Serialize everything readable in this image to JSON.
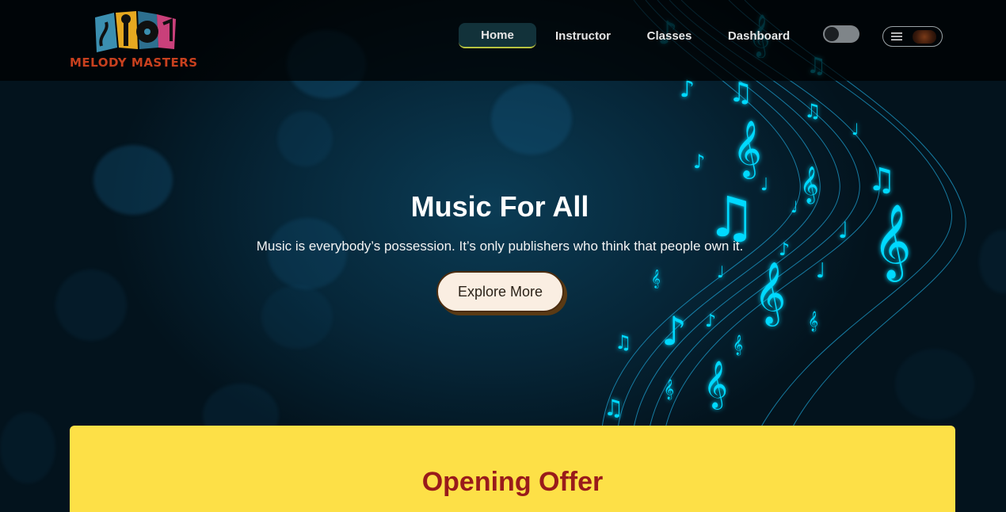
{
  "brand": {
    "name": "MELODY MASTERS",
    "logo_icon": "music-instruments-logo",
    "logo_color": "#c8401e"
  },
  "nav": {
    "items": [
      {
        "label": "Home",
        "active": true
      },
      {
        "label": "Instructor",
        "active": false
      },
      {
        "label": "Classes",
        "active": false
      },
      {
        "label": "Dashboard",
        "active": false
      }
    ],
    "theme_toggle": {
      "state": "off",
      "icon": "toggle-icon"
    },
    "menu_icon": "hamburger-icon",
    "avatar_icon": "user-avatar"
  },
  "hero": {
    "title": "Music For All",
    "subtitle": "Music is everybody’s possession. It’s only publishers who think that people own it.",
    "cta_label": "Explore More",
    "decoration": "glowing-music-notes"
  },
  "offer": {
    "title": "Opening Offer",
    "background": "#fde047",
    "title_color": "#991b1b"
  },
  "colors": {
    "accent": "#00e5ff",
    "page_bg": "#03121c"
  }
}
